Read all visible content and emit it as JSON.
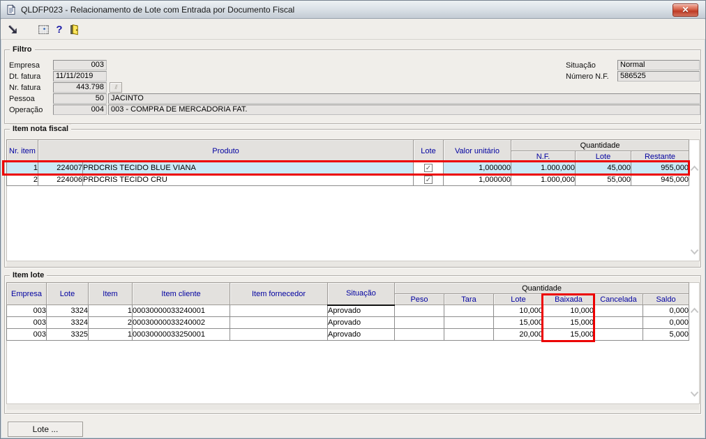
{
  "colors": {
    "annotation_red": "#EC0000",
    "selected_row_blue": "#CBE9F7",
    "header_text_blue": "#0000A0"
  },
  "window": {
    "title": "QLDFP023 - Relacionamento de Lote com Entrada por Documento Fiscal",
    "close_glyph": "✕",
    "icons": [
      "document-icon",
      "execute-icon",
      "grid-icon",
      "help-icon",
      "exit-icon"
    ]
  },
  "toolbar": {
    "help_glyph": "?"
  },
  "filtro": {
    "label": "Filtro",
    "empresa_label": "Empresa",
    "empresa_value": "003",
    "dt_fatura_label": "Dt. fatura",
    "dt_fatura_value": "11/11/2019",
    "nr_fatura_label": "Nr. fatura",
    "nr_fatura_value": "443.798",
    "pessoa_label": "Pessoa",
    "pessoa_code": "50",
    "pessoa_name": "JACINTO",
    "operacao_label": "Operação",
    "operacao_code": "004",
    "operacao_desc": "003 - COMPRA DE MERCADORIA FAT.",
    "situacao_label": "Situação",
    "situacao_value": "Normal",
    "numero_nf_label": "Número N.F.",
    "numero_nf_value": "586525"
  },
  "item_nota_fiscal": {
    "label": "Item nota fiscal",
    "headers": {
      "nr_item": "Nr. item",
      "produto": "Produto",
      "lote": "Lote",
      "valor_unitario": "Valor unitário",
      "quantidade": "Quantidade",
      "nf": "N.F.",
      "lote_q": "Lote",
      "restante": "Restante"
    },
    "rows": [
      {
        "nr": "1",
        "codigo": "224007",
        "descricao": "PRDCRIS TECIDO BLUE VIANA",
        "lote_check": "✓",
        "valor_unitario": "1,000000",
        "qtd_nf": "1.000,000",
        "qtd_lote": "45,000",
        "qtd_restante": "955,000"
      },
      {
        "nr": "2",
        "codigo": "224006",
        "descricao": "PRDCRIS TECIDO CRU",
        "lote_check": "✓",
        "valor_unitario": "1,000000",
        "qtd_nf": "1.000,000",
        "qtd_lote": "55,000",
        "qtd_restante": "945,000"
      }
    ]
  },
  "item_lote": {
    "label": "Item lote",
    "headers": {
      "empresa": "Empresa",
      "lote": "Lote",
      "item": "Item",
      "item_cliente": "Item cliente",
      "item_fornecedor": "Item fornecedor",
      "situacao": "Situação",
      "quantidade": "Quantidade",
      "peso": "Peso",
      "tara": "Tara",
      "lote_q": "Lote",
      "baixada": "Baixada",
      "cancelada": "Cancelada",
      "saldo": "Saldo"
    },
    "rows": [
      {
        "empresa": "003",
        "lote": "3324",
        "item": "1",
        "item_cliente": "00030000033240001",
        "item_fornecedor": "",
        "situacao": "Aprovado",
        "peso": "",
        "tara": "",
        "qtd_lote": "10,000",
        "baixada": "10,000",
        "cancelada": "",
        "saldo": "0,000"
      },
      {
        "empresa": "003",
        "lote": "3324",
        "item": "2",
        "item_cliente": "00030000033240002",
        "item_fornecedor": "",
        "situacao": "Aprovado",
        "peso": "",
        "tara": "",
        "qtd_lote": "15,000",
        "baixada": "15,000",
        "cancelada": "",
        "saldo": "0,000"
      },
      {
        "empresa": "003",
        "lote": "3325",
        "item": "1",
        "item_cliente": "00030000033250001",
        "item_fornecedor": "",
        "situacao": "Aprovado",
        "peso": "",
        "tara": "",
        "qtd_lote": "20,000",
        "baixada": "15,000",
        "cancelada": "",
        "saldo": "5,000"
      }
    ]
  },
  "footer": {
    "lote_button": "Lote ..."
  }
}
